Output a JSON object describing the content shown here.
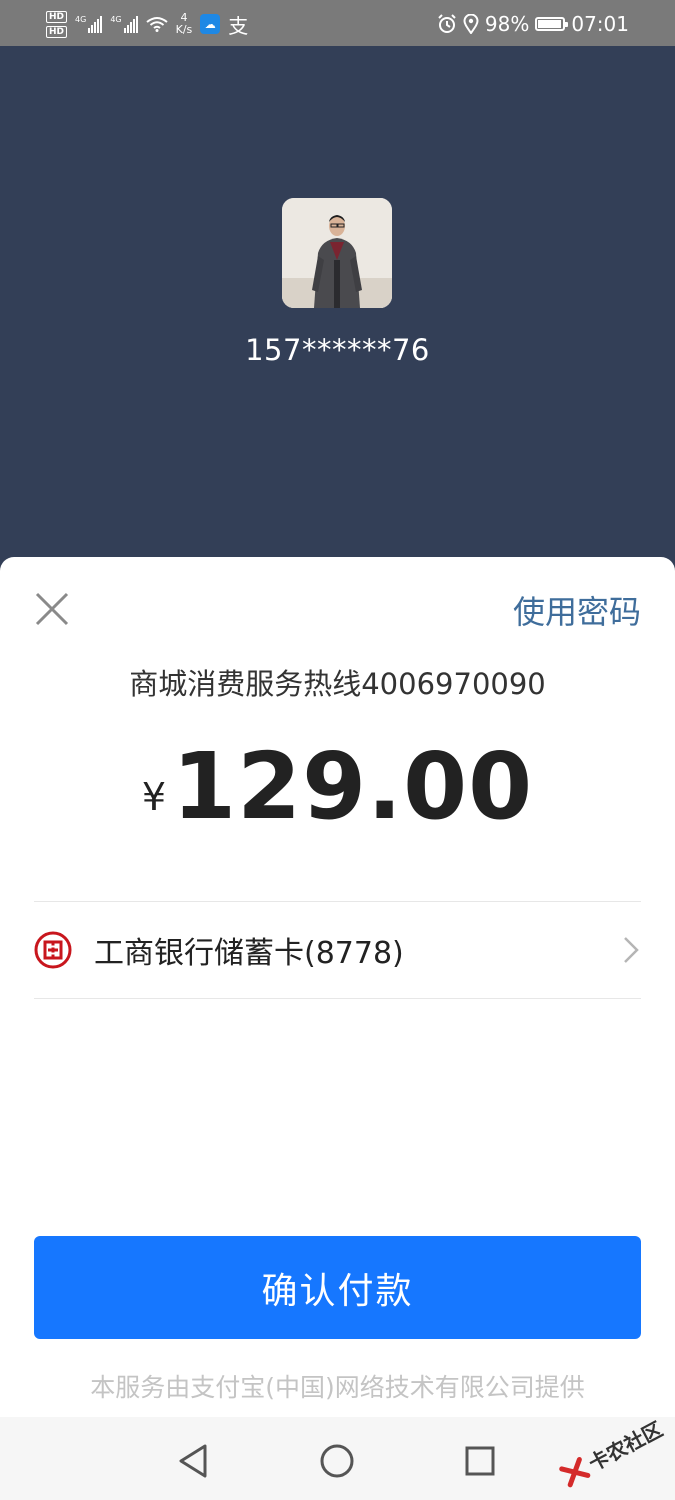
{
  "status_bar": {
    "hd1": "HD",
    "hd2": "HD",
    "net1": "4G",
    "net2": "4G",
    "speed_value": "4",
    "speed_unit": "K/s",
    "app_icon_text": "支",
    "battery": "98%",
    "time": "07:01",
    "icons": [
      "signal-icon",
      "wifi-icon",
      "alarm-icon",
      "location-icon",
      "battery-icon"
    ]
  },
  "payee": {
    "account": "157******76"
  },
  "sheet": {
    "use_password": "使用密码",
    "merchant": "商城消费服务热线4006970090",
    "currency": "¥",
    "amount": "129.00",
    "payment_method": "工商银行储蓄卡(8778)",
    "confirm": "确认付款",
    "provider": "本服务由支付宝(中国)网络技术有限公司提供"
  },
  "watermark": "卡农社区",
  "colors": {
    "header_bg": "#333f57",
    "status_bg": "#7a7a7a",
    "accent": "#1677ff",
    "link": "#3f6d9b",
    "bank_red": "#c8161d"
  }
}
